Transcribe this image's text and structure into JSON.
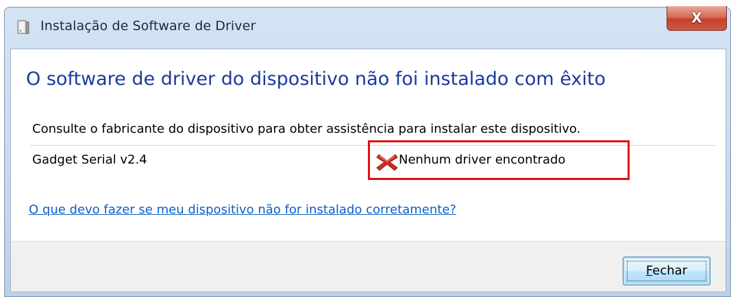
{
  "window": {
    "title": "Instalação de Software de Driver",
    "close_glyph": "X",
    "icon": "driver-setup-icon"
  },
  "content": {
    "main_instruction": "O software de driver do dispositivo não foi instalado com êxito",
    "description": "Consulte o fabricante do dispositivo para obter assistência para instalar este dispositivo.",
    "device": {
      "name": "Gadget Serial v2.4",
      "status_icon": "red-x-icon",
      "status": "Nenhum driver encontrado"
    },
    "help_link": "O que devo fazer se meu dispositivo não for instalado corretamente?"
  },
  "footer": {
    "close_button": {
      "accelerator": "F",
      "rest": "echar"
    }
  },
  "colors": {
    "main_instruction": "#1a3a9e",
    "link": "#0b5fc7",
    "highlight_box": "#e01010",
    "close_button": "#c3402a"
  }
}
